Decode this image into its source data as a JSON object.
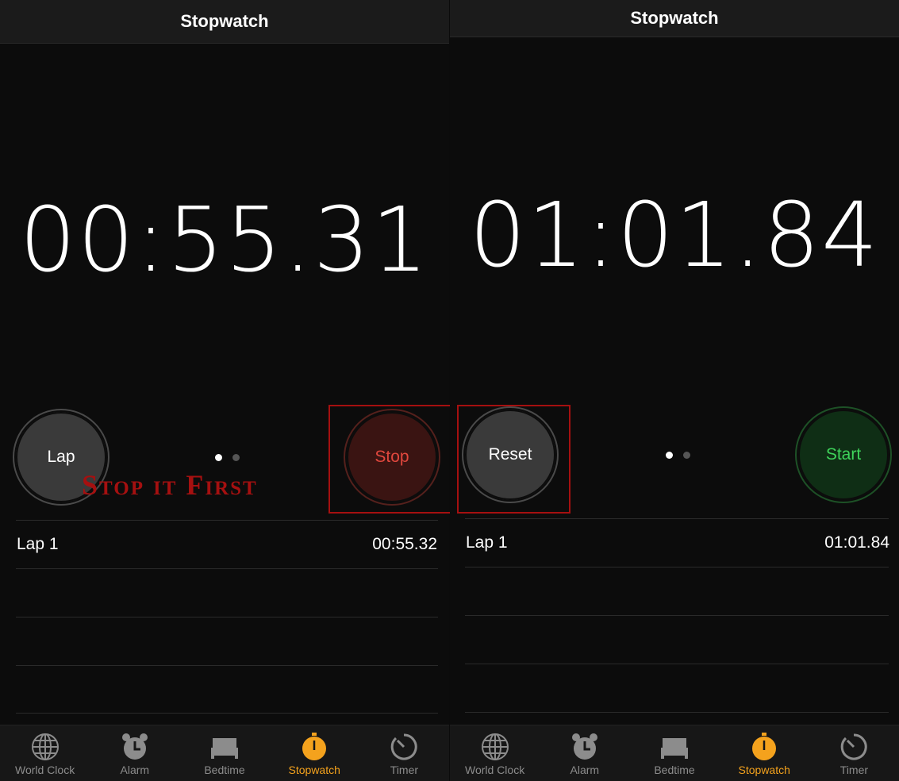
{
  "left": {
    "title": "Stopwatch",
    "time": "00:55.31",
    "left_button": "Lap",
    "right_button": "Stop",
    "laps": [
      {
        "label": "Lap 1",
        "time": "00:55.32"
      }
    ]
  },
  "right": {
    "title": "Stopwatch",
    "time": "01:01.84",
    "left_button": "Reset",
    "right_button": "Start",
    "laps": [
      {
        "label": "Lap 1",
        "time": "01:01.84"
      }
    ]
  },
  "annotation": "Stop it First",
  "tabs": [
    {
      "label": "World Clock",
      "icon": "globe-icon"
    },
    {
      "label": "Alarm",
      "icon": "alarm-clock-icon"
    },
    {
      "label": "Bedtime",
      "icon": "bed-icon"
    },
    {
      "label": "Stopwatch",
      "icon": "stopwatch-icon",
      "active": true
    },
    {
      "label": "Timer",
      "icon": "timer-icon"
    }
  ],
  "colors": {
    "active_tab": "#f4a21d",
    "stop": "#e0473d",
    "start": "#3ed35a",
    "highlight_box": "#a51010"
  }
}
